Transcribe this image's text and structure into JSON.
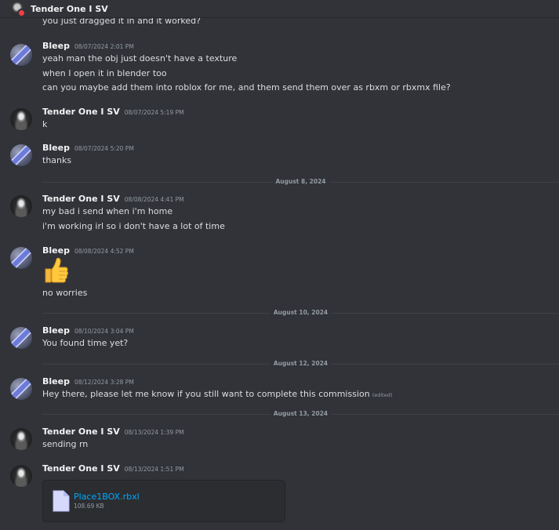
{
  "header": {
    "title": "Tender One I SV"
  },
  "cut_text": "you just dragged it in and it worked?",
  "messages": [
    {
      "author": "Bleep",
      "time": "08/07/2024 2:01 PM",
      "lines": [
        "yeah man the obj just doesn't have a texture",
        "when I open it in blender too",
        "can you maybe add them into roblox for me, and them send them over as rbxm or rbxmx file?"
      ]
    },
    {
      "author": "Tender One I SV",
      "time": "08/07/2024 5:19 PM",
      "lines": [
        "k"
      ]
    },
    {
      "author": "Bleep",
      "time": "08/07/2024 5:20 PM",
      "lines": [
        "thanks"
      ]
    },
    {
      "author": "Tender One I SV",
      "time": "08/08/2024 4:41 PM",
      "lines": [
        "my bad i send when i'm home",
        "i'm working irl so i don't have a lot of time"
      ]
    },
    {
      "author": "Bleep",
      "time": "08/08/2024 4:52 PM",
      "lines": [
        "no worries"
      ]
    },
    {
      "author": "Bleep",
      "time": "08/10/2024 3:04 PM",
      "lines": [
        "You found time yet?"
      ]
    },
    {
      "author": "Bleep",
      "time": "08/12/2024 3:28 PM",
      "lines": [
        "Hey there, please let me know if you still want to complete this commission"
      ],
      "edited": "(edited)"
    },
    {
      "author": "Tender One I SV",
      "time": "08/13/2024 1:39 PM",
      "lines": [
        "sending rn"
      ]
    },
    {
      "author": "Tender One I SV",
      "time": "08/13/2024 1:51 PM",
      "lines": []
    }
  ],
  "dividers": [
    "August 8, 2024",
    "August 10, 2024",
    "August 12, 2024",
    "August 13, 2024"
  ],
  "attachment": {
    "name": "Place1BOX.rbxl",
    "size": "108.69 KB"
  },
  "emoji": "thumbs-up",
  "colors": {
    "background": "#313338",
    "link": "#00a8fc",
    "muted": "#949ba4"
  }
}
